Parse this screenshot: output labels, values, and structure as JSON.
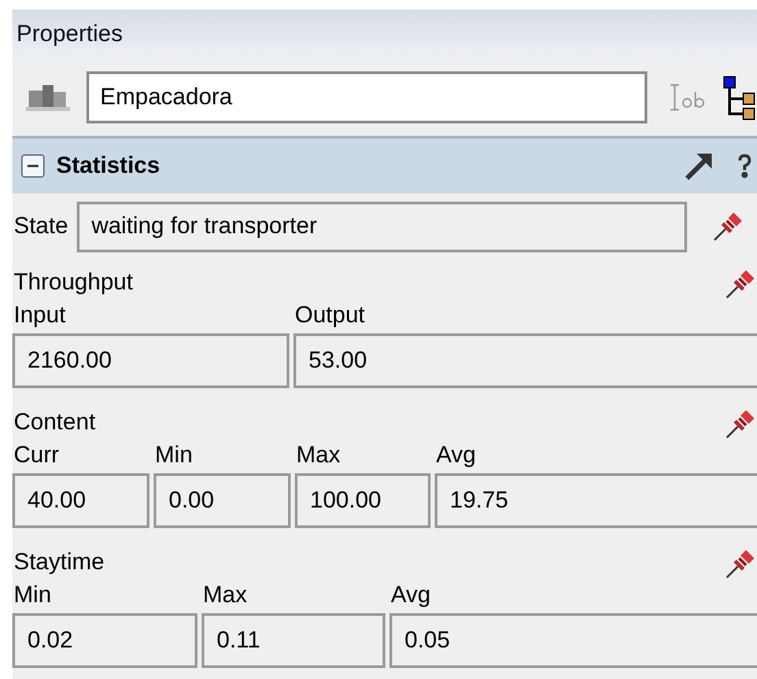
{
  "panel": {
    "title": "Properties"
  },
  "object": {
    "name": "Empacadora"
  },
  "section": {
    "title": "Statistics",
    "expanded": true
  },
  "state": {
    "label": "State",
    "value": "waiting for transporter"
  },
  "groups": [
    {
      "title": "Throughput",
      "fields": [
        {
          "label": "Input",
          "value": "2160.00"
        },
        {
          "label": "Output",
          "value": "53.00"
        }
      ]
    },
    {
      "title": "Content",
      "fields": [
        {
          "label": "Curr",
          "value": "40.00"
        },
        {
          "label": "Min",
          "value": "0.00"
        },
        {
          "label": "Max",
          "value": "100.00"
        },
        {
          "label": "Avg",
          "value": "19.75"
        }
      ]
    },
    {
      "title": "Staytime",
      "fields": [
        {
          "label": "Min",
          "value": "0.02"
        },
        {
          "label": "Max",
          "value": "0.11"
        },
        {
          "label": "Avg",
          "value": "0.05"
        }
      ]
    }
  ]
}
